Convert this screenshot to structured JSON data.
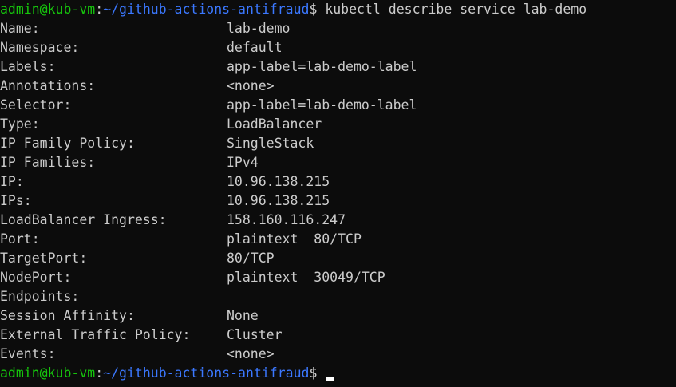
{
  "prompt": {
    "user_host": "admin@kub-vm",
    "separator": ":",
    "path": "~/github-actions-antifraud",
    "symbol": "$"
  },
  "command": "kubectl describe service lab-demo",
  "fields": [
    {
      "key": "Name:",
      "value": "lab-demo"
    },
    {
      "key": "Namespace:",
      "value": "default"
    },
    {
      "key": "Labels:",
      "value": "app-label=lab-demo-label"
    },
    {
      "key": "Annotations:",
      "value": "<none>"
    },
    {
      "key": "Selector:",
      "value": "app-label=lab-demo-label"
    },
    {
      "key": "Type:",
      "value": "LoadBalancer"
    },
    {
      "key": "IP Family Policy:",
      "value": "SingleStack"
    },
    {
      "key": "IP Families:",
      "value": "IPv4"
    },
    {
      "key": "IP:",
      "value": "10.96.138.215"
    },
    {
      "key": "IPs:",
      "value": "10.96.138.215"
    },
    {
      "key": "LoadBalancer Ingress:",
      "value": "158.160.116.247"
    },
    {
      "key": "Port:",
      "value": "plaintext  80/TCP"
    },
    {
      "key": "TargetPort:",
      "value": "80/TCP"
    },
    {
      "key": "NodePort:",
      "value": "plaintext  30049/TCP"
    },
    {
      "key": "Endpoints:",
      "value": ""
    },
    {
      "key": "Session Affinity:",
      "value": "None"
    },
    {
      "key": "External Traffic Policy:",
      "value": "Cluster"
    },
    {
      "key": "Events:",
      "value": "<none>"
    }
  ],
  "colors": {
    "background": "#0c0c0c",
    "text": "#cccccc",
    "prompt_user": "#16c60c",
    "prompt_path": "#3b78ff"
  }
}
